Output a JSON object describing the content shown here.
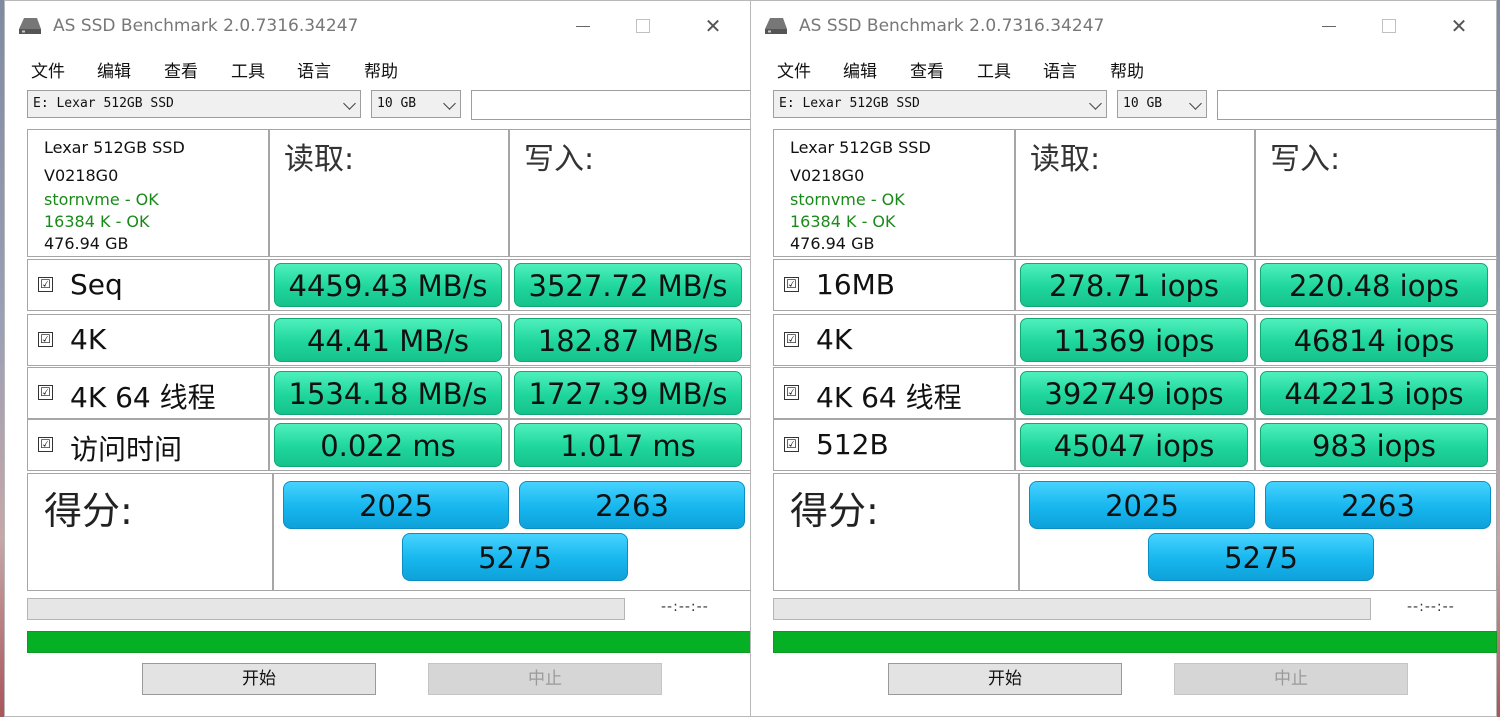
{
  "windows": [
    {
      "title": "AS SSD Benchmark 2.0.7316.34247",
      "menu": [
        "文件",
        "编辑",
        "查看",
        "工具",
        "语言",
        "帮助"
      ],
      "drive": "E: Lexar 512GB SSD",
      "size": "10 GB",
      "info": {
        "model": "Lexar 512GB SSD",
        "firmware": "V0218G0",
        "driver": "stornvme - OK",
        "alignment": "16384 K - OK",
        "capacity": "476.94 GB"
      },
      "read_header": "读取:",
      "write_header": "写入:",
      "rows": [
        {
          "label": "Seq",
          "read": "4459.43 MB/s",
          "write": "3527.72 MB/s"
        },
        {
          "label": "4K",
          "read": "44.41 MB/s",
          "write": "182.87 MB/s"
        },
        {
          "label": "4K 64 线程",
          "read": "1534.18 MB/s",
          "write": "1727.39 MB/s"
        },
        {
          "label": "访问时间",
          "read": "0.022 ms",
          "write": "1.017 ms"
        }
      ],
      "score_label": "得分:",
      "score": {
        "read": "2025",
        "write": "2263",
        "total": "5275"
      },
      "time": "--:--:--",
      "progress": 1.0,
      "buttons": {
        "start": "开始",
        "stop": "中止"
      }
    },
    {
      "title": "AS SSD Benchmark 2.0.7316.34247",
      "menu": [
        "文件",
        "编辑",
        "查看",
        "工具",
        "语言",
        "帮助"
      ],
      "drive": "E: Lexar 512GB SSD",
      "size": "10 GB",
      "info": {
        "model": "Lexar 512GB SSD",
        "firmware": "V0218G0",
        "driver": "stornvme - OK",
        "alignment": "16384 K - OK",
        "capacity": "476.94 GB"
      },
      "read_header": "读取:",
      "write_header": "写入:",
      "rows": [
        {
          "label": "16MB",
          "read": "278.71 iops",
          "write": "220.48 iops"
        },
        {
          "label": "4K",
          "read": "11369 iops",
          "write": "46814 iops"
        },
        {
          "label": "4K 64 线程",
          "read": "392749 iops",
          "write": "442213 iops"
        },
        {
          "label": "512B",
          "read": "45047 iops",
          "write": "983 iops"
        }
      ],
      "score_label": "得分:",
      "score": {
        "read": "2025",
        "write": "2263",
        "total": "5275"
      },
      "time": "--:--:--",
      "progress": 1.0,
      "buttons": {
        "start": "开始",
        "stop": "中止"
      }
    }
  ]
}
